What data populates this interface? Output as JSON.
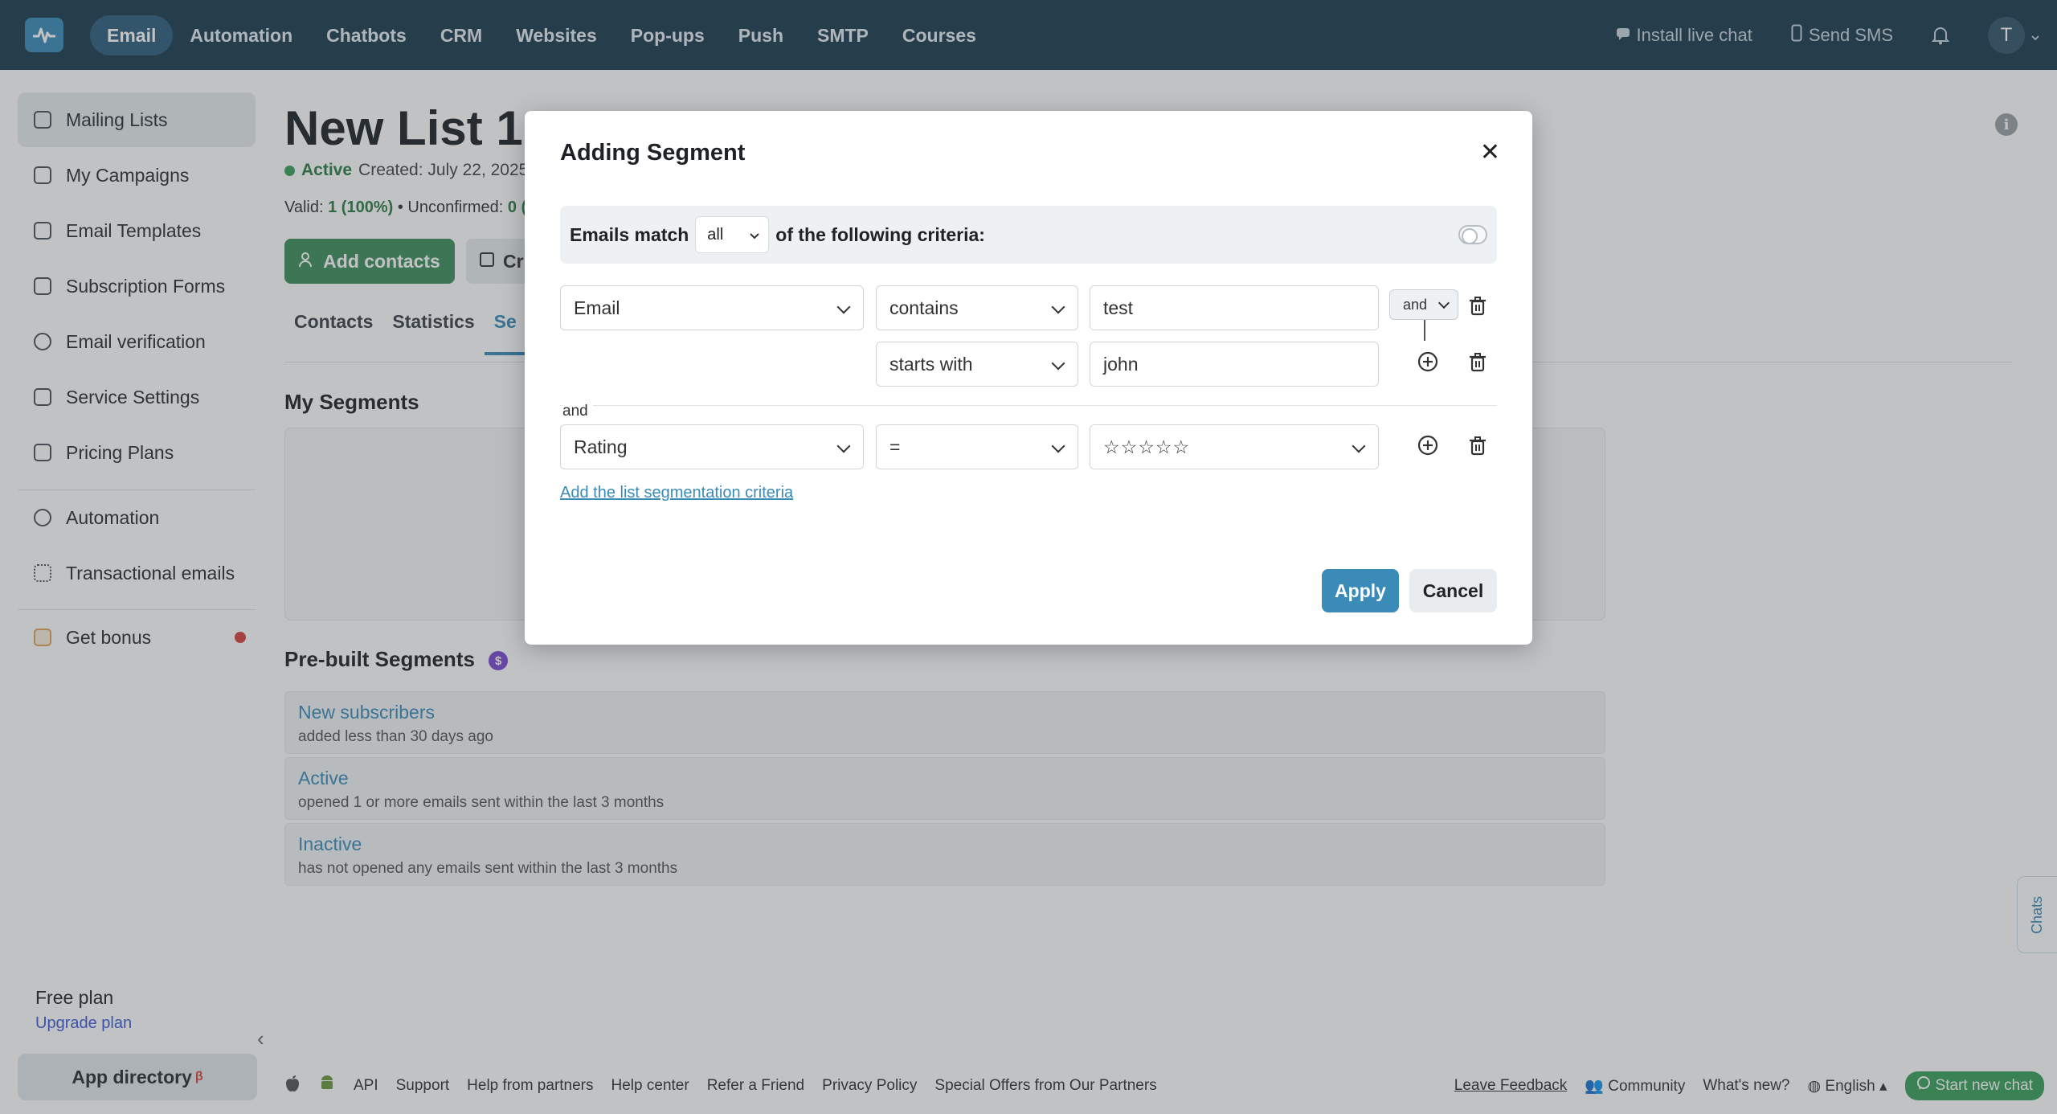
{
  "topnav": {
    "items": [
      "Email",
      "Automation",
      "Chatbots",
      "CRM",
      "Websites",
      "Pop-ups",
      "Push",
      "SMTP",
      "Courses"
    ],
    "active": "Email",
    "install_live_chat": "Install live chat",
    "send_sms": "Send SMS",
    "avatar_letter": "T"
  },
  "sidebar": {
    "items": [
      {
        "label": "Mailing Lists",
        "icon": "contacts-icon"
      },
      {
        "label": "My Campaigns",
        "icon": "campaigns-icon"
      },
      {
        "label": "Email Templates",
        "icon": "templates-icon"
      },
      {
        "label": "Subscription Forms",
        "icon": "forms-icon"
      },
      {
        "label": "Email verification",
        "icon": "check-circle-icon"
      },
      {
        "label": "Service Settings",
        "icon": "settings-icon"
      },
      {
        "label": "Pricing Plans",
        "icon": "pricing-icon"
      },
      {
        "label": "Automation",
        "icon": "automation-icon"
      },
      {
        "label": "Transactional emails",
        "icon": "grid-icon"
      },
      {
        "label": "Get bonus",
        "icon": "gift-icon"
      }
    ],
    "free_plan": "Free plan",
    "upgrade_plan": "Upgrade plan",
    "app_directory": "App directory",
    "beta": "β"
  },
  "main": {
    "title": "New List 1",
    "status": "Active",
    "created": "Created: July 22, 2025",
    "valid_label": "Valid:",
    "valid_value": "1 (100%)",
    "unconfirmed_label": "• Unconfirmed:",
    "unconfirmed_value": "0 (",
    "add_contacts": "Add contacts",
    "cr_button": "Cr",
    "tabs": [
      "Contacts",
      "Statistics",
      "Se"
    ],
    "my_segments": "My Segments",
    "prebuilt_title": "Pre-built Segments",
    "prebuilt_badge": "$",
    "prebuilt": [
      {
        "name": "New subscribers",
        "desc": "added less than 30 days ago"
      },
      {
        "name": "Active",
        "desc": "opened 1 or more emails sent within the last 3 months"
      },
      {
        "name": "Inactive",
        "desc": "has not opened any emails sent within the last 3 months"
      }
    ]
  },
  "modal": {
    "title": "Adding Segment",
    "match_prefix": "Emails match",
    "match_value": "all",
    "match_suffix": "of the following criteria:",
    "rows": [
      {
        "field": "Email",
        "operator": "contains",
        "value": "test",
        "join": "and"
      },
      {
        "operator": "starts with",
        "value": "john"
      },
      {
        "field": "Rating",
        "operator": "=",
        "value": "☆☆☆☆☆"
      }
    ],
    "group_join": "and",
    "add_criteria": "Add the list segmentation criteria",
    "apply": "Apply",
    "cancel": "Cancel"
  },
  "footer": {
    "left": [
      "API",
      "Support",
      "Help from partners",
      "Help center",
      "Refer a Friend",
      "Privacy Policy",
      "Special Offers from Our Partners"
    ],
    "leave_feedback": "Leave Feedback",
    "community": "Community",
    "whats_new": "What's new?",
    "language": "English",
    "start_chat": "Start new chat",
    "chats_tab": "Chats"
  },
  "colors": {
    "nav_bg": "#1d3b4f",
    "accent": "#3a8bb8",
    "green": "#3f8f5b"
  }
}
